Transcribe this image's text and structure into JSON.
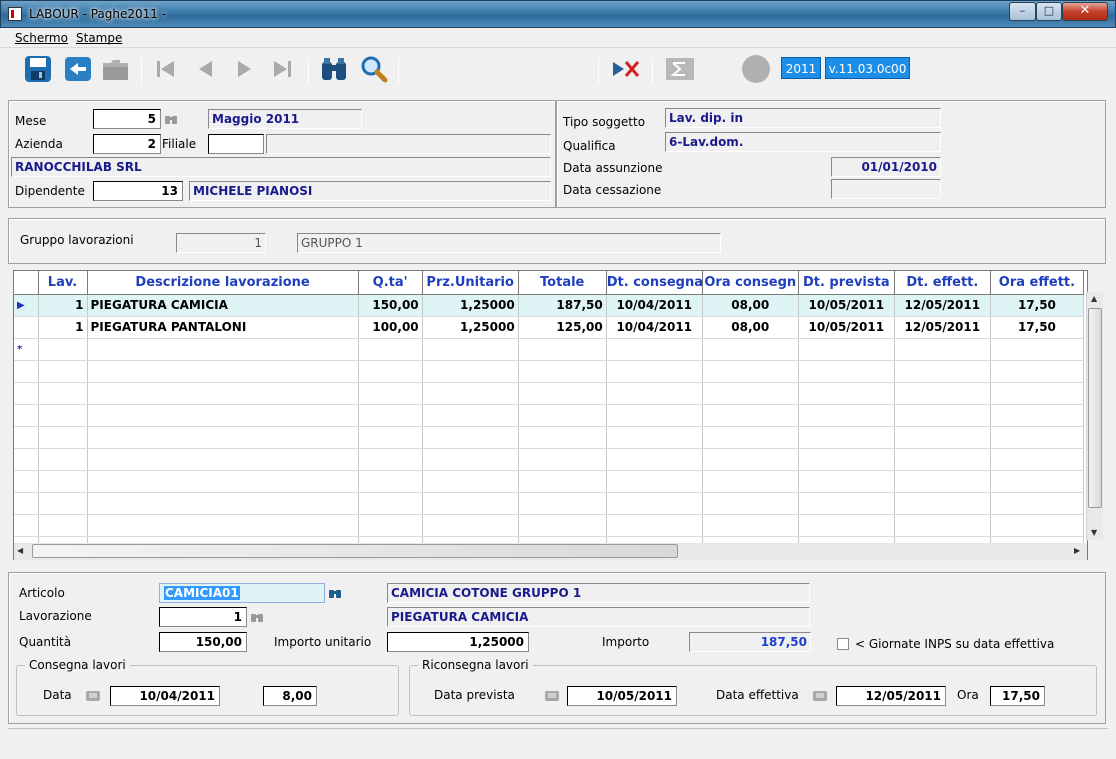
{
  "window": {
    "title": "LABOUR - Paghe2011 -",
    "min": "–",
    "max": "□",
    "close": "✕"
  },
  "menu": {
    "items": [
      "Schermo",
      "Stampe"
    ]
  },
  "toolbar": {
    "year": "2011",
    "version": "v.11.03.0c00",
    "icons": [
      "save-icon",
      "back-icon",
      "folder-icon",
      "first-icon",
      "prev-icon",
      "next-icon",
      "last-icon",
      "binoculars-icon",
      "magnifier-icon",
      "delete-icon",
      "sigma-icon",
      "status-circle-icon"
    ]
  },
  "header": {
    "mese_label": "Mese",
    "mese": "5",
    "mese_desc": "Maggio   2011",
    "azienda_label": "Azienda",
    "azienda": "2",
    "filiale_label": "Filiale",
    "filiale": "",
    "filiale_desc": "",
    "company": "RANOCCHILAB SRL",
    "dipendente_label": "Dipendente",
    "dipendente": "13",
    "dipendente_name": "MICHELE PIANOSI",
    "tipo_label": "Tipo soggetto",
    "tipo": "Lav. dip. in",
    "qualifica_label": "Qualifica",
    "qualifica": "6-Lav.dom.",
    "assunzione_label": "Data assunzione",
    "assunzione": "01/01/2010",
    "cessazione_label": "Data cessazione",
    "cessazione": ""
  },
  "gruppo": {
    "label": "Gruppo lavorazioni",
    "code": "1",
    "desc": "GRUPPO 1"
  },
  "grid": {
    "columns": [
      "Lav.",
      "Descrizione lavorazione",
      "Q.ta'",
      "Prz.Unitario",
      "Totale",
      "Dt. consegna",
      "Ora consegn",
      "Dt. prevista",
      "Dt. effett.",
      "Ora effett."
    ],
    "rows": [
      {
        "ind": "▶",
        "lav": "1",
        "desc": "PIEGATURA CAMICIA",
        "qta": "150,00",
        "prz": "1,25000",
        "tot": "187,50",
        "dtc": "10/04/2011",
        "orac": "08,00",
        "dtp": "10/05/2011",
        "dte": "12/05/2011",
        "orae": "17,50"
      },
      {
        "ind": "",
        "lav": "1",
        "desc": "PIEGATURA PANTALONI",
        "qta": "100,00",
        "prz": "1,25000",
        "tot": "125,00",
        "dtc": "10/04/2011",
        "orac": "08,00",
        "dtp": "10/05/2011",
        "dte": "12/05/2011",
        "orae": "17,50"
      },
      {
        "ind": "*",
        "lav": "",
        "desc": "",
        "qta": "",
        "prz": "",
        "tot": "",
        "dtc": "",
        "orac": "",
        "dtp": "",
        "dte": "",
        "orae": ""
      }
    ],
    "empty_rows": 9
  },
  "detail": {
    "articolo_label": "Articolo",
    "articolo": "CAMICIA01",
    "articolo_desc": "CAMICIA COTONE GRUPPO 1",
    "lavorazione_label": "Lavorazione",
    "lavorazione": "1",
    "lavorazione_desc": "PIEGATURA CAMICIA",
    "quantita_label": "Quantità",
    "quantita": "150,00",
    "importo_unit_label": "Importo unitario",
    "importo_unit": "1,25000",
    "importo_label": "Importo",
    "importo": "187,50",
    "inps_label": "< Giornate INPS su data effettiva",
    "consegna_title": "Consegna lavori",
    "data_label": "Data",
    "consegna_data": "10/04/2011",
    "consegna_ora": "8,00",
    "riconsegna_title": "Riconsegna lavori",
    "prevista_label": "Data prevista",
    "prevista": "10/05/2011",
    "effettiva_label": "Data effettiva",
    "effettiva": "12/05/2011",
    "ora_label": "Ora",
    "ora": "17,50"
  },
  "colors": {
    "accent": "#1e8fe8",
    "header_text": "#1f3fbf",
    "selected_row": "#dff5f5",
    "readonly_text": "#1a1a8c"
  }
}
